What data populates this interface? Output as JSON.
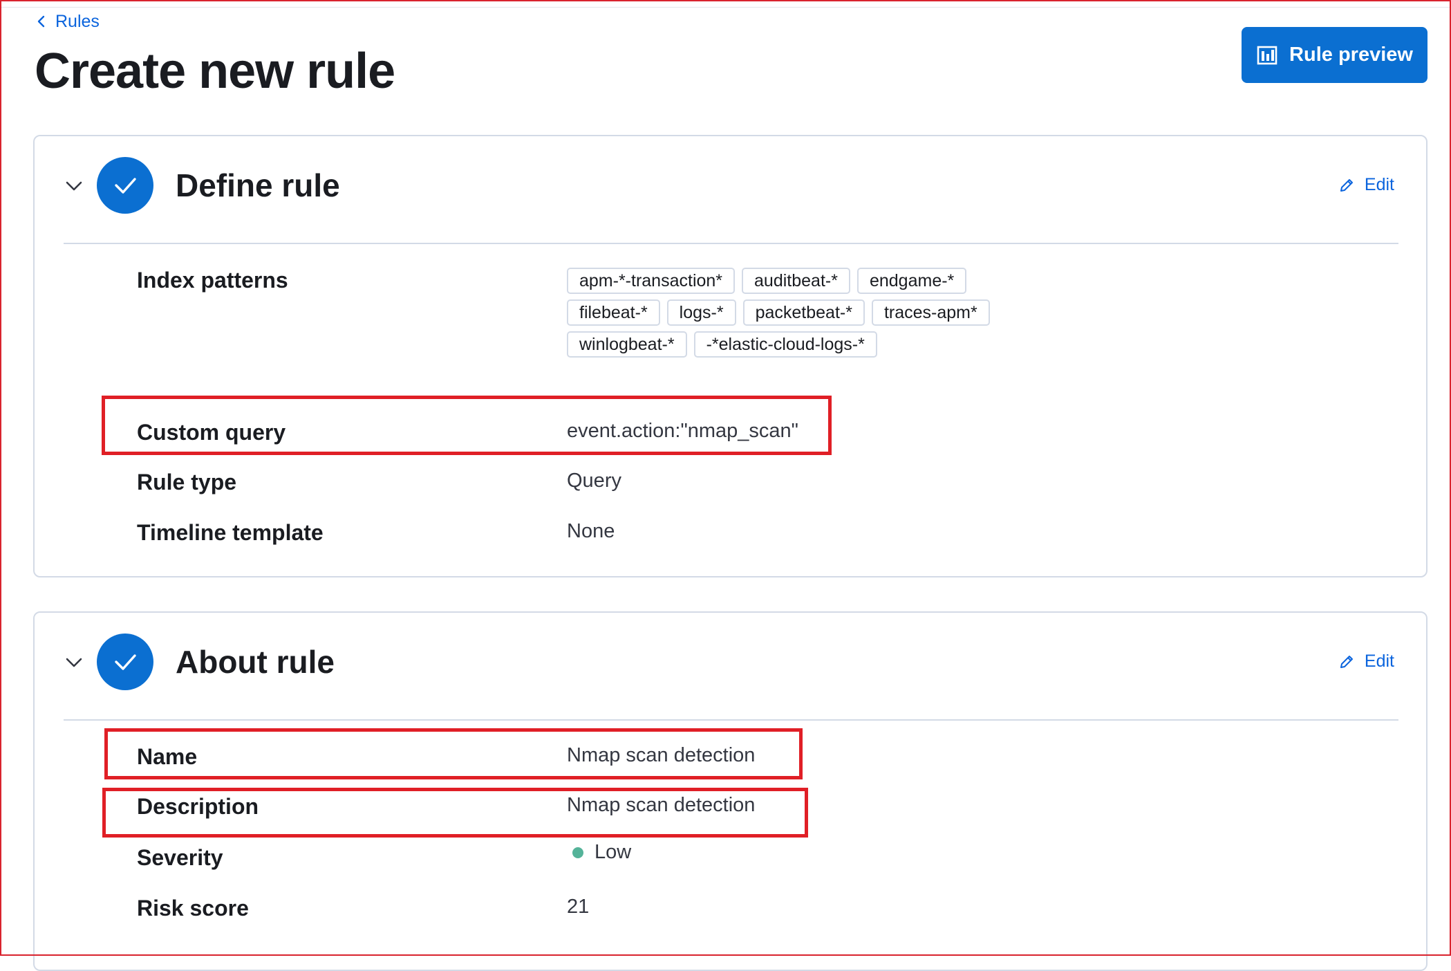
{
  "breadcrumb": {
    "label": "Rules"
  },
  "page": {
    "title": "Create new rule"
  },
  "header": {
    "preview_button": "Rule preview"
  },
  "define_rule": {
    "title": "Define rule",
    "edit_label": "Edit",
    "index_patterns_label": "Index patterns",
    "index_patterns": [
      "apm-*-transaction*",
      "auditbeat-*",
      "endgame-*",
      "filebeat-*",
      "logs-*",
      "packetbeat-*",
      "traces-apm*",
      "winlogbeat-*",
      "-*elastic-cloud-logs-*"
    ],
    "custom_query_label": "Custom query",
    "custom_query": "event.action:\"nmap_scan\"",
    "rule_type_label": "Rule type",
    "rule_type": "Query",
    "timeline_template_label": "Timeline template",
    "timeline_template": "None"
  },
  "about_rule": {
    "title": "About rule",
    "edit_label": "Edit",
    "name_label": "Name",
    "name": "Nmap scan detection",
    "description_label": "Description",
    "description": "Nmap scan detection",
    "severity_label": "Severity",
    "severity": "Low",
    "severity_color": "#54b399",
    "risk_score_label": "Risk score",
    "risk_score": "21"
  },
  "colors": {
    "accent": "#0b6fd1",
    "highlight": "#e01f26"
  },
  "icons": [
    "arrow-left-icon",
    "chart-preview-icon",
    "chevron-down-icon",
    "check-icon",
    "pencil-icon"
  ]
}
